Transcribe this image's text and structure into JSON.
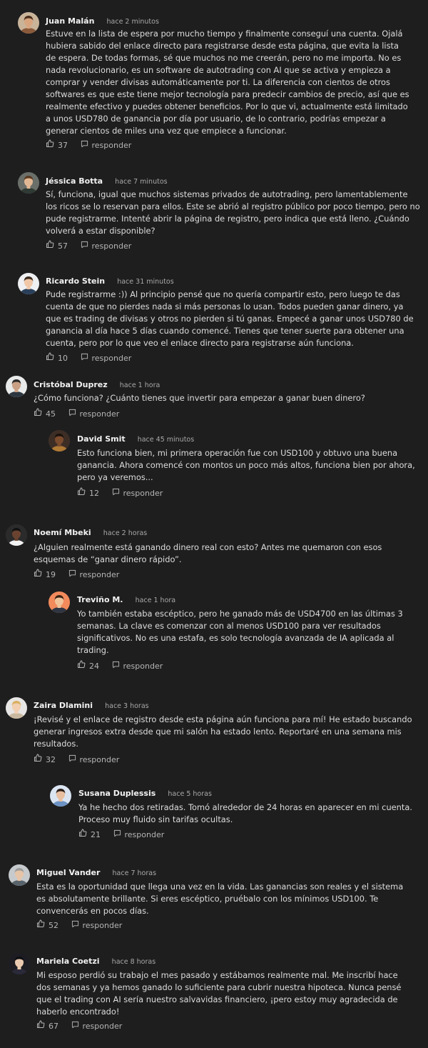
{
  "comments": [
    {
      "name": "Juan Malán",
      "time": "hace 2 minutos",
      "likes": "37",
      "reply": "responder",
      "text": "Estuve en la lista de espera por mucho tiempo y finalmente conseguí una cuenta. Ojalá hubiera sabido del enlace directo para registrarse desde esta página, que evita la lista de espera. De todas formas, sé que muchos no me creerán, pero no me importa. No es nada revolucionario, es un software de autotrading con AI que se activa y empieza a comprar y vender divisas automáticamente por ti. La diferencia con cientos de otros softwares es que este tiene mejor tecnología para predecir cambios de precio, así que es realmente efectivo y puedes obtener beneficios. Por lo que vi, actualmente está limitado a unos USD780 de ganancia por día por usuario, de lo contrario, podrías empezar a generar cientos de miles una vez que empiece a funcionar."
    },
    {
      "name": "Jéssica Botta",
      "time": "hace 7 minutos",
      "likes": "57",
      "reply": "responder",
      "text": "Sí, funciona, igual que muchos sistemas privados de autotrading, pero lamentablemente los ricos se lo reservan para ellos. Este se abrió al registro público por poco tiempo, pero no pude registrarme. Intenté abrir la página de registro, pero indica que está lleno. ¿Cuándo volverá a estar disponible?"
    },
    {
      "name": "Ricardo Stein",
      "time": "hace 31 minutos",
      "likes": "10",
      "reply": "responder",
      "text": "Pude registrarme :)) Al principio pensé que no quería compartir esto, pero luego te das cuenta de que no pierdes nada si más personas lo usan. Todos pueden ganar dinero, ya que es trading de divisas y otros no pierden si tú ganas. Empecé a ganar unos USD780 de ganancia al día hace 5 días cuando comencé. Tienes que tener suerte para obtener una cuenta, pero por lo que veo el enlace directo para registrarse aún funciona."
    },
    {
      "name": "Cristóbal Duprez",
      "time": "hace 1 hora",
      "likes": "45",
      "reply": "responder",
      "text": "¿Cómo funciona? ¿Cuánto tienes que invertir para empezar a ganar buen dinero?"
    },
    {
      "name": "David Smit",
      "time": "hace 45 minutos",
      "likes": "12",
      "reply": "responder",
      "text": "Esto funciona bien, mi primera operación fue con USD100 y obtuvo una buena ganancia. Ahora comencé con montos un poco más altos, funciona bien por ahora, pero ya veremos..."
    },
    {
      "name": "Noemí Mbeki",
      "time": "hace 2 horas",
      "likes": "19",
      "reply": "responder",
      "text": "¿Alguien realmente está ganando dinero real con esto? Antes me quemaron con esos esquemas de “ganar dinero rápido”."
    },
    {
      "name": "Treviño M.",
      "time": "hace 1 hora",
      "likes": "24",
      "reply": "responder",
      "text": "Yo también estaba escéptico, pero he ganado más de USD4700 en las últimas 3 semanas. La clave es comenzar con al menos USD100 para ver resultados significativos. No es una estafa, es solo tecnología avanzada de IA aplicada al trading."
    },
    {
      "name": "Zaira Dlamini",
      "time": "hace 3 horas",
      "likes": "32",
      "reply": "responder",
      "text": "¡Revisé y el enlace de registro desde esta página aún funciona para mí! He estado buscando generar ingresos extra desde que mi salón ha estado lento. Reportaré en una semana mis resultados."
    },
    {
      "name": "Susana Duplessis",
      "time": "hace 5 horas",
      "likes": "21",
      "reply": "responder",
      "text": "Ya he hecho dos retiradas. Tomó alrededor de 24 horas en aparecer en mi cuenta. Proceso muy fluido sin tarifas ocultas."
    },
    {
      "name": "Miguel Vander",
      "time": "hace 7 horas",
      "likes": "52",
      "reply": "responder",
      "text": "Esta es la oportunidad que llega una vez en la vida. Las ganancias son reales y el sistema es absolutamente brillante. Si eres escéptico, pruébalo con los mínimos USD100. Te convencerás en pocos días."
    },
    {
      "name": "Mariela Coetzi",
      "time": "hace 8 horas",
      "likes": "67",
      "reply": "responder",
      "text": "Mi esposo perdió su trabajo el mes pasado y estábamos realmente mal. Me inscribí hace dos semanas y ya hemos ganado lo suficiente para cubrir nuestra hipoteca. Nunca pensé que el trading con AI sería nuestro salvavidas financiero, ¡pero estoy muy agradecida de haberlo encontrado!"
    }
  ],
  "avatar_colors": [
    {
      "bg": "#c9b49a",
      "skin": "#d8a57f",
      "hair": "#4a2e1c",
      "shirt": "#8a5a3a"
    },
    {
      "bg": "#6b6f6a",
      "skin": "#e2b894",
      "hair": "#5a3a22",
      "shirt": "#2f3a34"
    },
    {
      "bg": "#eef0f2",
      "skin": "#f0c8a8",
      "hair": "#3b2a1e",
      "shirt": "#2a3f5a"
    },
    {
      "bg": "#e9eaea",
      "skin": "#caa084",
      "hair": "#2b2b2b",
      "shirt": "#2c3640"
    },
    {
      "bg": "#3d2e25",
      "skin": "#7b4b2e",
      "hair": "#1a120d",
      "shirt": "#b07a35"
    },
    {
      "bg": "#2b2b2b",
      "skin": "#6a4330",
      "hair": "#111111",
      "shirt": "#f2f2f2"
    },
    {
      "bg": "#f28a5b",
      "skin": "#f0c39a",
      "hair": "#3a2414",
      "shirt": "#2f3542"
    },
    {
      "bg": "#e8e6e4",
      "skin": "#f1cfb0",
      "hair": "#d9b061",
      "shirt": "#c9b8a0"
    },
    {
      "bg": "#dbe5f2",
      "skin": "#e8bfa0",
      "hair": "#2a1d16",
      "shirt": "#6d93c5"
    },
    {
      "bg": "#c7cacc",
      "skin": "#e6c4a8",
      "hair": "#9b9b9b",
      "shirt": "#59636b"
    },
    {
      "bg": "#1c1c22",
      "skin": "#e9c9b0",
      "hair": "#0e0e12",
      "shirt": "#2a2a3a"
    }
  ]
}
